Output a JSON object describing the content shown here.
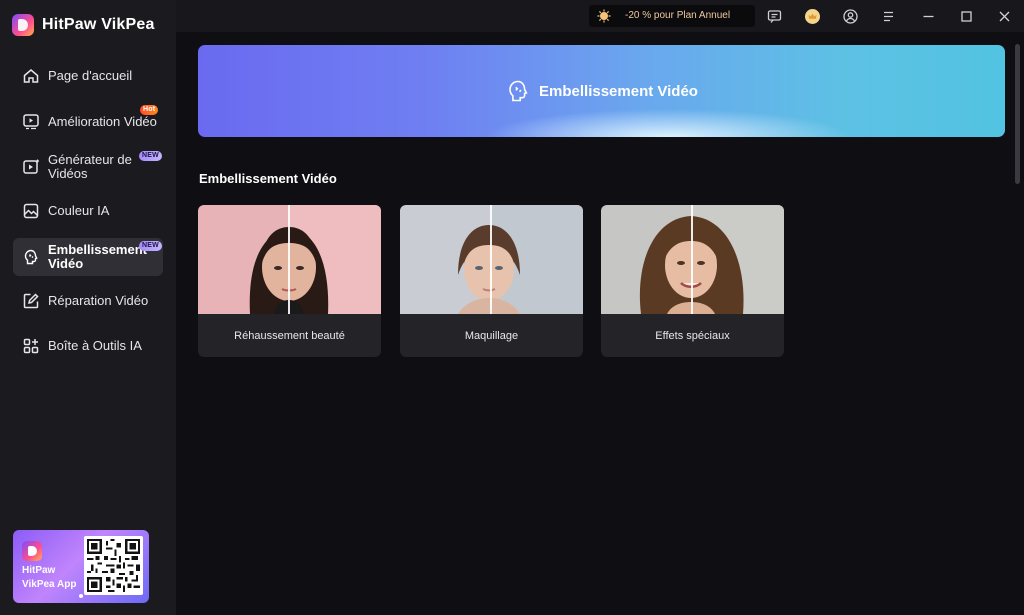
{
  "app": {
    "name": "HitPaw VikPea"
  },
  "sidebar": {
    "items": [
      {
        "label": "Page d'accueil",
        "icon": "home-icon"
      },
      {
        "label": "Amélioration Vidéo",
        "icon": "video-enhance-icon",
        "badge": "Hot"
      },
      {
        "label_line1": "Générateur de",
        "label_line2": "Vidéos",
        "icon": "video-generator-icon",
        "badge": "NEW"
      },
      {
        "label": "Couleur IA",
        "icon": "color-icon"
      },
      {
        "label_line1": "Embellissement",
        "label_line2": "Vidéo",
        "icon": "beauty-icon",
        "badge": "NEW",
        "active": true
      },
      {
        "label": "Réparation Vidéo",
        "icon": "repair-icon"
      },
      {
        "label": "Boîte à Outils IA",
        "icon": "toolbox-icon"
      }
    ],
    "promo": {
      "line1": "HitPaw",
      "line2": "VikPea App"
    }
  },
  "topbar": {
    "offer_text": "-20 % pour Plan Annuel",
    "icons": [
      "feedback-icon",
      "crown-icon",
      "user-icon",
      "menu-icon",
      "minimize-icon",
      "maximize-icon",
      "close-icon"
    ]
  },
  "main": {
    "hero_title": "Embellissement Vidéo",
    "section_title": "Embellissement Vidéo",
    "cards": [
      {
        "label": "Réhaussement beauté"
      },
      {
        "label": "Maquillage"
      },
      {
        "label": "Effets spéciaux"
      }
    ]
  },
  "colors": {
    "sidebar_bg": "#1b1b1f",
    "main_bg": "#0f0e13",
    "active_item_bg": "#2f2f35",
    "hero_gradient_start": "#6a6af0",
    "hero_gradient_end": "#52c3e2",
    "hot_badge": "#ff4a2a",
    "new_badge": "#a78bfa"
  }
}
